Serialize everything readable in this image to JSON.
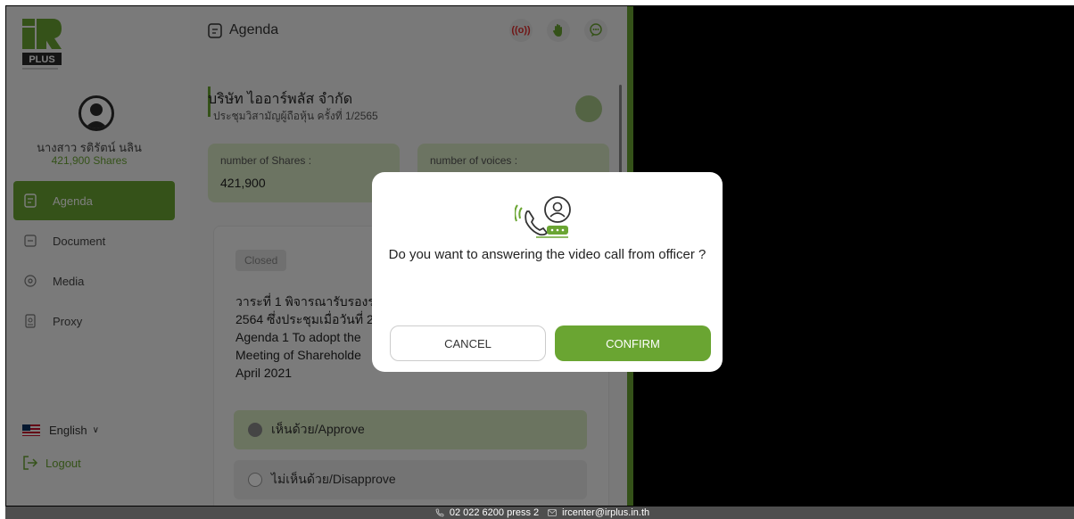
{
  "sidebar": {
    "user_name": "นางสาว รติรัตน์ นลิน",
    "user_shares": "421,900 Shares",
    "items": [
      {
        "label": "Agenda",
        "active": true,
        "icon": "agenda-icon"
      },
      {
        "label": "Document",
        "active": false,
        "icon": "document-icon"
      },
      {
        "label": "Media",
        "active": false,
        "icon": "media-icon"
      },
      {
        "label": "Proxy",
        "active": false,
        "icon": "proxy-icon"
      }
    ],
    "language": "English",
    "logout": "Logout"
  },
  "header": {
    "title": "Agenda",
    "icons": [
      "live-icon",
      "raise-hand-icon",
      "chat-icon"
    ]
  },
  "company": {
    "name": "บริษัท ไออาร์พลัส จำกัด",
    "meeting": "ประชุมวิสามัญผู้ถือหุ้น ครั้งที่ 1/2565"
  },
  "cards": {
    "shares_label": "number of Shares :",
    "shares_value": "421,900",
    "voices_label": "number of voices :"
  },
  "agenda": {
    "status": "Closed",
    "line1": "วาระที่ 1 พิจารณารับรองรา",
    "line2": "2564 ซึ่งประชุมเมื่อวันที่ 2",
    "line3": "Agenda 1 To adopt the",
    "line4": "Meeting of Shareholde",
    "line5": "April 2021",
    "approve": "เห็นด้วย/Approve",
    "disapprove": "ไม่เห็นด้วย/Disapprove"
  },
  "modal": {
    "message": "Do you want to answering the video call from officer ?",
    "cancel": "CANCEL",
    "confirm": "CONFIRM"
  },
  "footer": {
    "phone": "02 022 6200 press 2",
    "email": "ircenter@irplus.in.th"
  },
  "colors": {
    "accent": "#6aa532",
    "live": "#e02b2b"
  }
}
